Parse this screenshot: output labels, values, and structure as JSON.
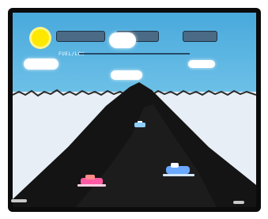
{
  "screen": {
    "sky_color": "#49a9dc",
    "snow_color": "#e7eef5",
    "mountain_color": "#141414",
    "sun_color": "#ffe800"
  },
  "hud": {
    "fuel_label": "FUEL/LOW",
    "score_bar_color": "#4a6a86"
  },
  "sprites": {
    "player": {
      "label": "player-snowmobile",
      "color": "#ff5aa3"
    },
    "enemy": {
      "label": "enemy-snowmobile",
      "color": "#6aa9ff"
    },
    "drone": {
      "label": "enemy-marker",
      "color": "#8fd0ff"
    }
  }
}
